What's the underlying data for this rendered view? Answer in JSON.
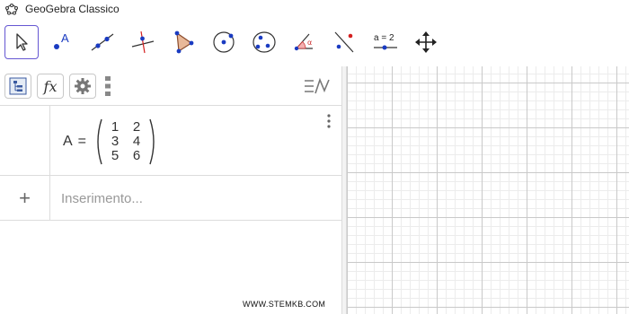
{
  "window": {
    "title": "GeoGebra Classico"
  },
  "toolbar": {
    "tools": [
      {
        "icon": "move-arrow-icon",
        "selected": true
      },
      {
        "icon": "point-icon",
        "selected": false
      },
      {
        "icon": "line-icon",
        "selected": false
      },
      {
        "icon": "perpendicular-line-icon",
        "selected": false
      },
      {
        "icon": "polygon-icon",
        "selected": false
      },
      {
        "icon": "circle-center-point-icon",
        "selected": false
      },
      {
        "icon": "ellipse-icon",
        "selected": false
      },
      {
        "icon": "angle-icon",
        "selected": false
      },
      {
        "icon": "reflect-icon",
        "selected": false
      },
      {
        "icon": "slider-icon",
        "label": "a = 2",
        "selected": false
      },
      {
        "icon": "move-graphics-view-icon",
        "selected": false
      }
    ]
  },
  "algebra_view": {
    "header_buttons": [
      "algebra-view-toggle-icon",
      "function-icon",
      "settings-gear-icon",
      "drag-handle-icon",
      "keyboard-toggle-icon"
    ],
    "function_label": "fx",
    "matrix": {
      "name": "A",
      "equals": "=",
      "open_paren": "(",
      "close_paren": ")",
      "rows": [
        [
          "1",
          "2"
        ],
        [
          "3",
          "4"
        ],
        [
          "5",
          "6"
        ]
      ]
    },
    "input": {
      "plus": "+",
      "placeholder": "Inserimento..."
    }
  },
  "watermark": "WWW.STEMKB.COM",
  "colors": {
    "accent": "#6557d2",
    "point_blue": "#1a3bc1",
    "grid_major": "#c9c9c9",
    "grid_minor": "#ececec"
  }
}
